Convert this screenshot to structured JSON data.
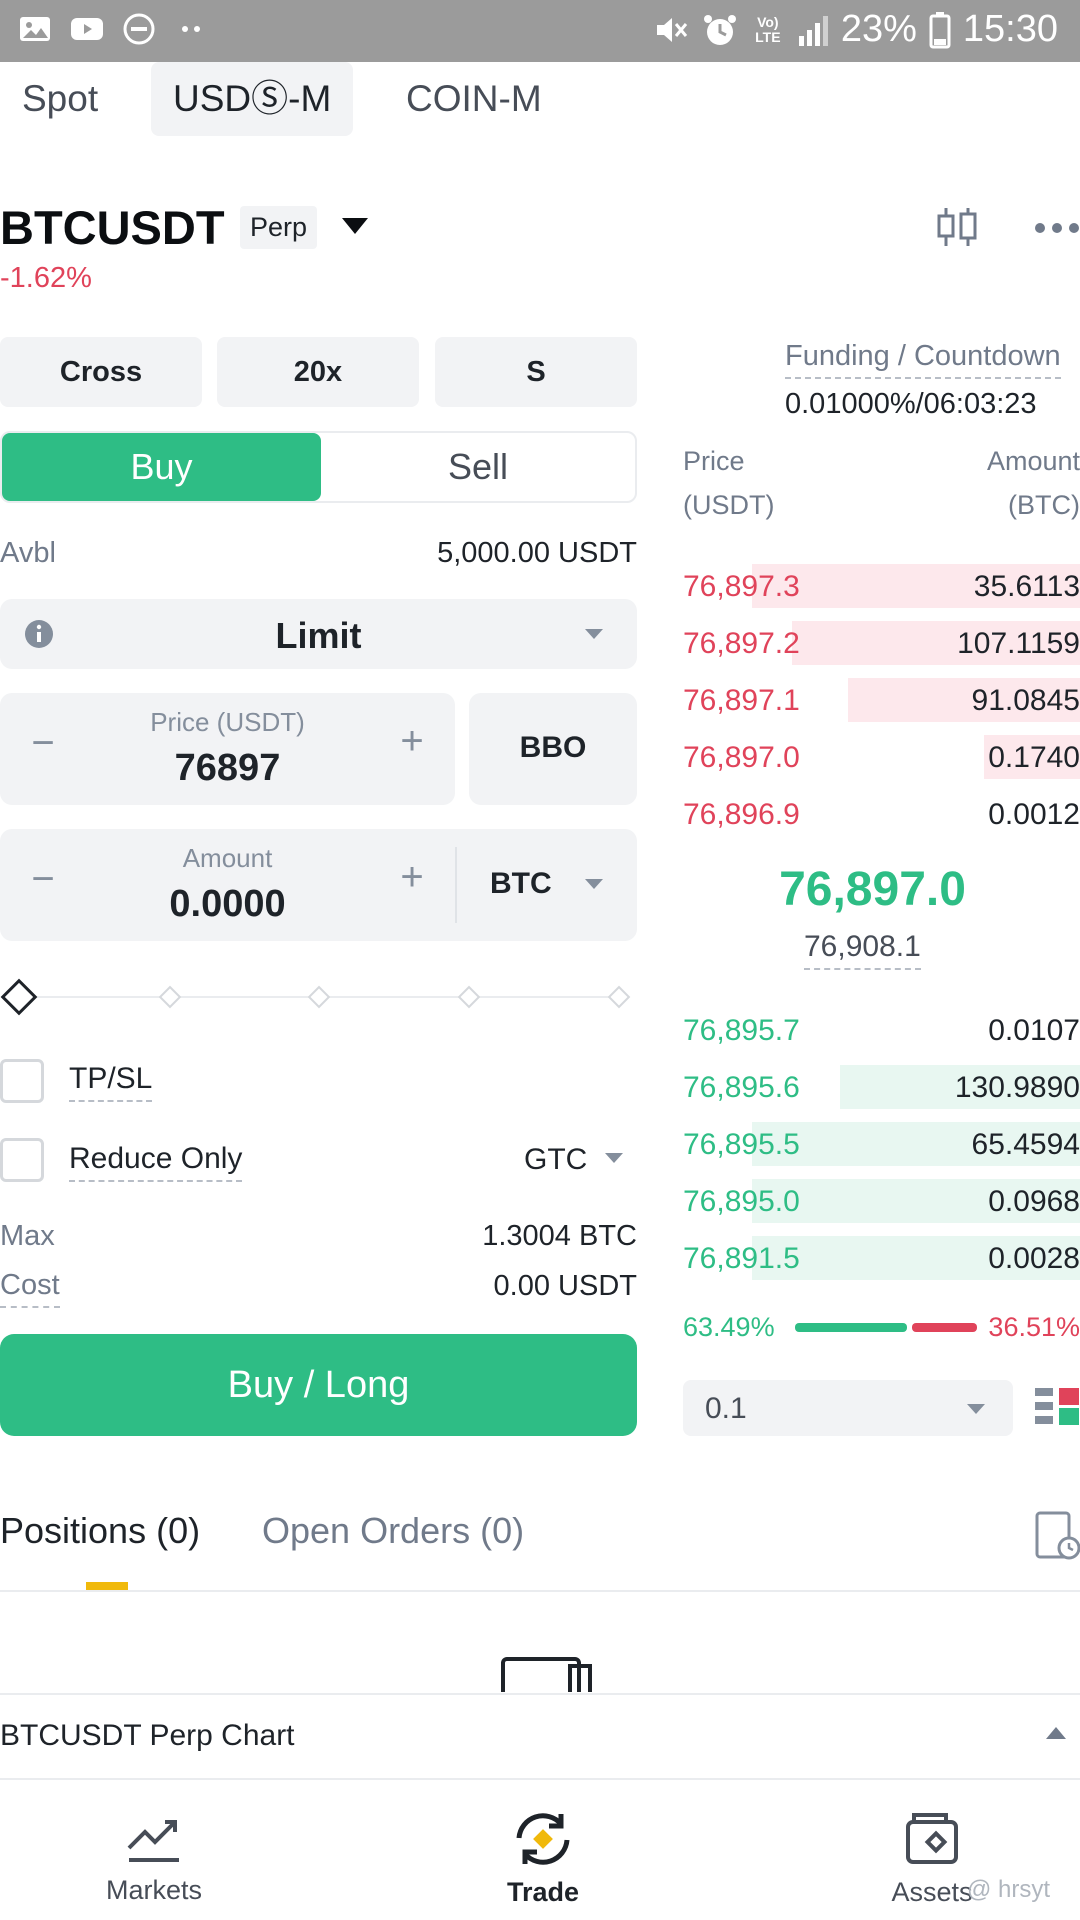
{
  "status_bar": {
    "volte_label": "Vo) LTE",
    "battery": "23%",
    "time": "15:30"
  },
  "market_tabs": [
    "Spot",
    "USDⓈ-M",
    "COIN-M"
  ],
  "pair": {
    "symbol": "BTCUSDT",
    "badge": "Perp",
    "change": "-1.62%"
  },
  "settings": {
    "margin_mode": "Cross",
    "leverage": "20x",
    "asset_mode": "S"
  },
  "funding": {
    "label": "Funding / Countdown",
    "value": "0.01000%/06:03:23"
  },
  "side_toggle": {
    "buy": "Buy",
    "sell": "Sell"
  },
  "available": {
    "label": "Avbl",
    "value": "5,000.00 USDT"
  },
  "order_type": "Limit",
  "price_field": {
    "label": "Price (USDT)",
    "value": "76897",
    "bbo": "BBO"
  },
  "amount_field": {
    "label": "Amount",
    "value": "0.0000",
    "unit": "BTC"
  },
  "slider_level": 0,
  "options": {
    "tpsl": "TP/SL",
    "reduce_only": "Reduce Only",
    "tif": "GTC"
  },
  "max": {
    "label": "Max",
    "value": "1.3004 BTC"
  },
  "cost": {
    "label": "Cost",
    "value": "0.00 USDT"
  },
  "buy_long": "Buy / Long",
  "orderbook": {
    "price_header": "Price",
    "price_unit": "(USDT)",
    "amount_header": "Amount",
    "amount_unit": "(BTC)",
    "asks": [
      {
        "price": "76,897.3",
        "amount": "35.6113",
        "depth": 0.82
      },
      {
        "price": "76,897.2",
        "amount": "107.1159",
        "depth": 0.72
      },
      {
        "price": "76,897.1",
        "amount": "91.0845",
        "depth": 0.58
      },
      {
        "price": "76,897.0",
        "amount": "0.1740",
        "depth": 0.24
      },
      {
        "price": "76,896.9",
        "amount": "0.0012",
        "depth": 0.0
      }
    ],
    "bids": [
      {
        "price": "76,895.7",
        "amount": "0.0107",
        "depth": 0.0
      },
      {
        "price": "76,895.6",
        "amount": "130.9890",
        "depth": 0.6
      },
      {
        "price": "76,895.5",
        "amount": "65.4594",
        "depth": 0.82
      },
      {
        "price": "76,895.0",
        "amount": "0.0968",
        "depth": 0.82
      },
      {
        "price": "76,891.5",
        "amount": "0.0028",
        "depth": 0.82
      }
    ],
    "last_price": "76,897.0",
    "mark_price": "76,908.1",
    "buy_ratio": "63.49%",
    "sell_ratio": "36.51%",
    "depth_step": "0.1"
  },
  "bottom_tabs": {
    "positions": "Positions (0)",
    "open_orders": "Open Orders (0)"
  },
  "chart_bar": {
    "title": "BTCUSDT Perp Chart"
  },
  "nav": {
    "markets": "Markets",
    "trade": "Trade",
    "assets": "Assets"
  },
  "watermark": "@ hrsyt",
  "colors": {
    "buy_green": "#2ebd85",
    "sell_red": "#e0435a",
    "accent_yellow": "#f0b90b"
  }
}
